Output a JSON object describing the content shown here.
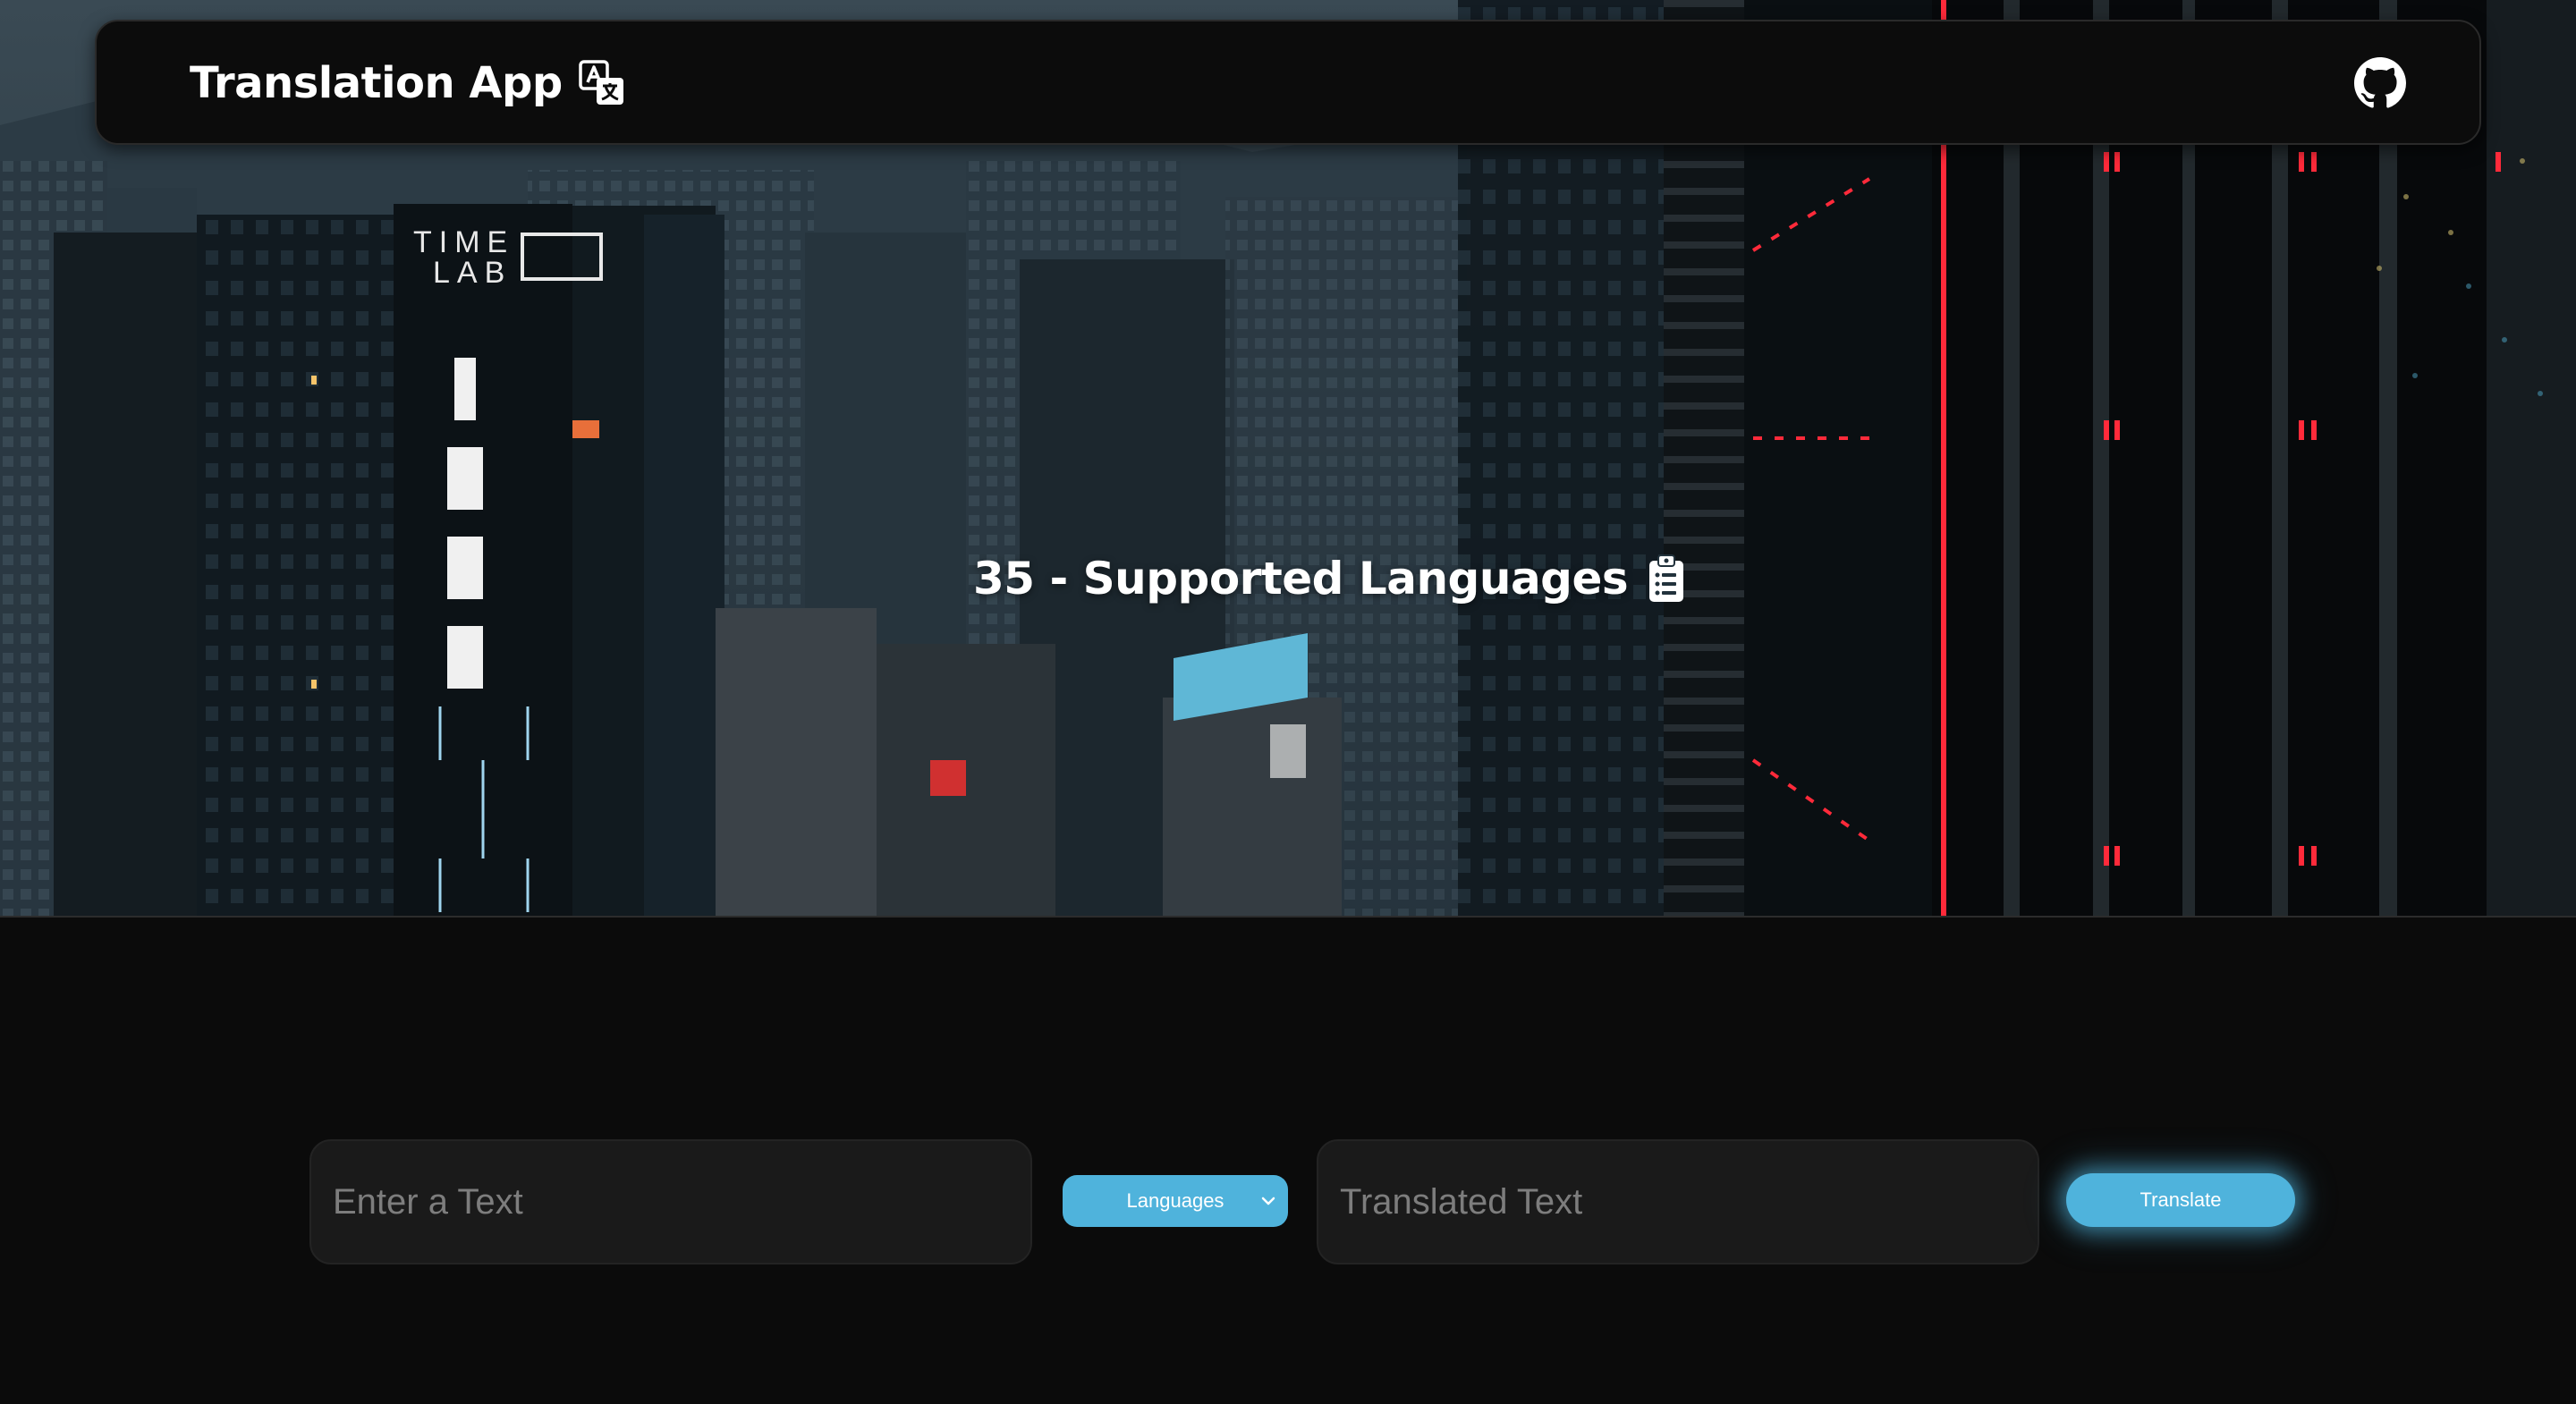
{
  "navbar": {
    "title": "Translation App",
    "translate_icon": "translate-icon",
    "github_icon": "github-icon"
  },
  "hero": {
    "headline": "35 - Supported Languages",
    "headline_icon": "clipboard-list-icon"
  },
  "form": {
    "input_placeholder": "Enter a Text",
    "language_select_label": "Languages",
    "output_placeholder": "Translated Text",
    "translate_button_label": "Translate"
  },
  "colors": {
    "accent": "#4fb3dc",
    "page_background": "#0b0b0b",
    "navbar_background": "#0c0c0c",
    "field_background": "#1a1a1a"
  }
}
